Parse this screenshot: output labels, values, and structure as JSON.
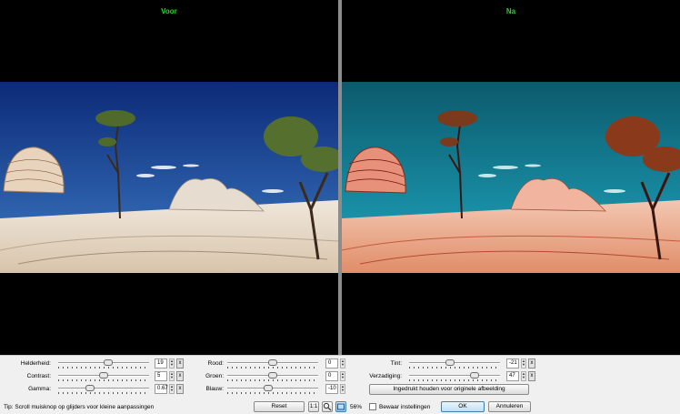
{
  "preview": {
    "before_title": "Voor",
    "after_title": "Na",
    "title_color": "#2bd52b"
  },
  "controls": {
    "helderheid": {
      "label": "Helderheid:",
      "value": "19",
      "level": 0.55
    },
    "contrast": {
      "label": "Contrast:",
      "value": "5",
      "level": 0.5
    },
    "gamma": {
      "label": "Gamma:",
      "value": "0.67",
      "level": 0.35
    },
    "rood": {
      "label": "Rood:",
      "value": "0",
      "level": 0.5
    },
    "groen": {
      "label": "Groen:",
      "value": "0",
      "level": 0.5
    },
    "blauw": {
      "label": "Blauw:",
      "value": "-10",
      "level": 0.45
    },
    "tint": {
      "label": "Tint:",
      "value": "-21",
      "level": 0.45
    },
    "verzadiging": {
      "label": "Verzadiging:",
      "value": "47",
      "level": 0.72
    },
    "reset_x": "x"
  },
  "buttons": {
    "hold_original": "Ingedrukt houden voor originele afbeelding",
    "reset": "Reset",
    "ratio": "1:1",
    "ok": "OK",
    "cancel": "Annuleren"
  },
  "zoom": "56%",
  "save_settings": {
    "label": "Bewaar instellingen",
    "checked": false
  },
  "tip": "Tip: Scroll muisknop op glijders voor kleine aanpassingen"
}
